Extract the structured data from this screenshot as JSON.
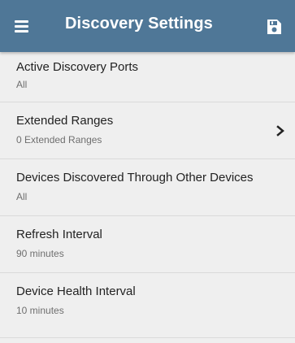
{
  "header": {
    "title": "Discovery Settings",
    "menu_icon": "menu-icon",
    "save_icon": "save-icon",
    "color": "#4f7797"
  },
  "settings": [
    {
      "label": "Active Discovery Ports",
      "value": "All"
    },
    {
      "label": "Extended Ranges",
      "value": "0 Extended Ranges",
      "icon": "chevron-right-icon"
    },
    {
      "label": "Devices Discovered Through Other Devices",
      "value": "All"
    },
    {
      "label": "Refresh Interval",
      "value": "90 minutes"
    },
    {
      "label": "Device Health Interval",
      "value": "10 minutes"
    }
  ]
}
